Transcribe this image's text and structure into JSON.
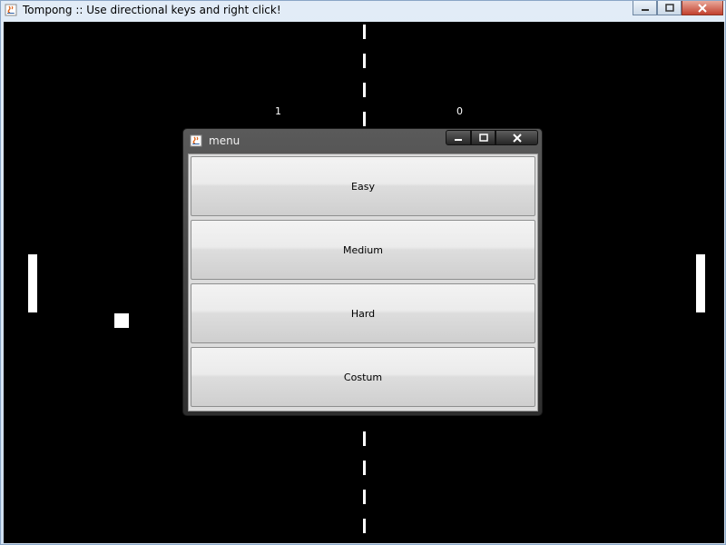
{
  "window": {
    "title": "Tompong ::  Use directional keys and right click!",
    "icon": "java-cup-icon",
    "controls": [
      "minimize-icon",
      "maximize-icon",
      "close-icon"
    ]
  },
  "game": {
    "score_left": "1",
    "score_right": "0",
    "background_color": "#000000",
    "foreground_color": "#ffffff"
  },
  "dialog": {
    "title": "menu",
    "icon": "java-cup-icon",
    "buttons": [
      "Easy",
      "Medium",
      "Hard",
      "Costum"
    ]
  }
}
